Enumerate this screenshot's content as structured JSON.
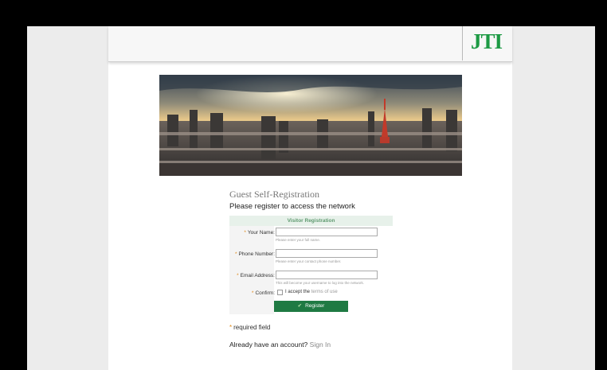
{
  "header": {
    "logo_text": "JTI",
    "logo_color": "#1d9a44"
  },
  "banner": {
    "icon": "tokyo-skyline-photo"
  },
  "page": {
    "title": "Guest Self-Registration",
    "subtitle": "Please register to access the network"
  },
  "form": {
    "heading": "Visitor Registration",
    "fields": [
      {
        "label": "Your Name:",
        "value": "",
        "hint": "Please enter your full name."
      },
      {
        "label": "Phone Number:",
        "value": "",
        "hint": "Please enter your contact phone number."
      },
      {
        "label": "Email Address:",
        "value": "",
        "hint": "This will become your username to log into the network."
      }
    ],
    "confirm_label": "Confirm:",
    "confirm_prefix": "I accept the",
    "terms_link": "terms of use",
    "required_marker": "*",
    "register_label": "Register",
    "register_color": "#1f7a43"
  },
  "footer": {
    "required_note": "required field",
    "account_question": "Already have an account?",
    "sign_in": "Sign In"
  }
}
